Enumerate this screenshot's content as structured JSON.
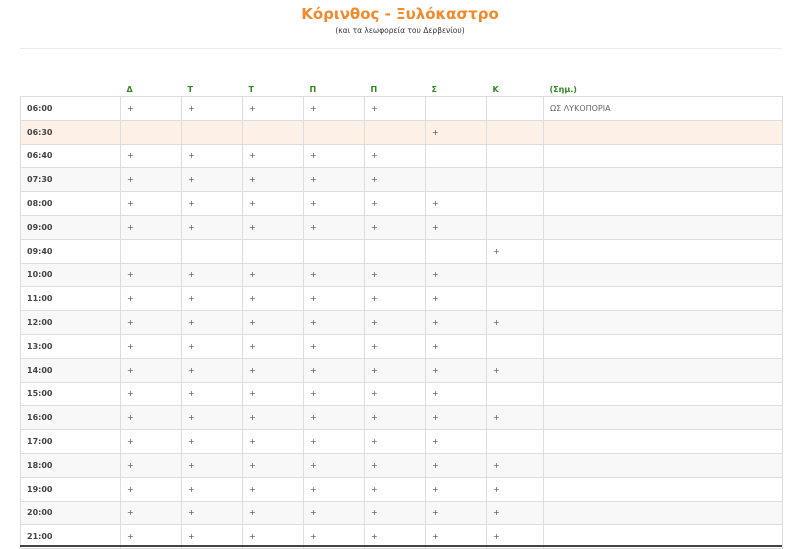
{
  "header": {
    "title": "Κόρινθος - Ξυλόκαστρο",
    "subtitle": "(και τα λεωφορεία του Δερβενίου)"
  },
  "colors": {
    "title": "#f08a2a",
    "day_headers": "#2e8b1e",
    "highlight_row": "#fdf0e6"
  },
  "table": {
    "columns": [
      "",
      "Δ",
      "Τ",
      "Τ",
      "Π",
      "Π",
      "Σ",
      "Κ",
      "(Σημ.)"
    ],
    "rows": [
      {
        "time": "06:00",
        "cells": [
          "+",
          "+",
          "+",
          "+",
          "+",
          "",
          ""
        ],
        "note": "ΩΣ ΛΥΚΟΠΟΡΙΑ",
        "highlight": false
      },
      {
        "time": "06:30",
        "cells": [
          "",
          "",
          "",
          "",
          "",
          "+",
          ""
        ],
        "note": "",
        "highlight": true
      },
      {
        "time": "06:40",
        "cells": [
          "+",
          "+",
          "+",
          "+",
          "+",
          "",
          ""
        ],
        "note": "",
        "highlight": false
      },
      {
        "time": "07:30",
        "cells": [
          "+",
          "+",
          "+",
          "+",
          "+",
          "",
          ""
        ],
        "note": "",
        "highlight": false
      },
      {
        "time": "08:00",
        "cells": [
          "+",
          "+",
          "+",
          "+",
          "+",
          "+",
          ""
        ],
        "note": "",
        "highlight": false
      },
      {
        "time": "09:00",
        "cells": [
          "+",
          "+",
          "+",
          "+",
          "+",
          "+",
          ""
        ],
        "note": "",
        "highlight": false
      },
      {
        "time": "09:40",
        "cells": [
          "",
          "",
          "",
          "",
          "",
          "",
          "+"
        ],
        "note": "",
        "highlight": false
      },
      {
        "time": "10:00",
        "cells": [
          "+",
          "+",
          "+",
          "+",
          "+",
          "+",
          ""
        ],
        "note": "",
        "highlight": false
      },
      {
        "time": "11:00",
        "cells": [
          "+",
          "+",
          "+",
          "+",
          "+",
          "+",
          ""
        ],
        "note": "",
        "highlight": false
      },
      {
        "time": "12:00",
        "cells": [
          "+",
          "+",
          "+",
          "+",
          "+",
          "+",
          "+"
        ],
        "note": "",
        "highlight": false
      },
      {
        "time": "13:00",
        "cells": [
          "+",
          "+",
          "+",
          "+",
          "+",
          "+",
          ""
        ],
        "note": "",
        "highlight": false
      },
      {
        "time": "14:00",
        "cells": [
          "+",
          "+",
          "+",
          "+",
          "+",
          "+",
          "+"
        ],
        "note": "",
        "highlight": false
      },
      {
        "time": "15:00",
        "cells": [
          "+",
          "+",
          "+",
          "+",
          "+",
          "+",
          ""
        ],
        "note": "",
        "highlight": false
      },
      {
        "time": "16:00",
        "cells": [
          "+",
          "+",
          "+",
          "+",
          "+",
          "+",
          "+"
        ],
        "note": "",
        "highlight": false
      },
      {
        "time": "17:00",
        "cells": [
          "+",
          "+",
          "+",
          "+",
          "+",
          "+",
          ""
        ],
        "note": "",
        "highlight": false
      },
      {
        "time": "18:00",
        "cells": [
          "+",
          "+",
          "+",
          "+",
          "+",
          "+",
          "+"
        ],
        "note": "",
        "highlight": false
      },
      {
        "time": "19:00",
        "cells": [
          "+",
          "+",
          "+",
          "+",
          "+",
          "+",
          "+"
        ],
        "note": "",
        "highlight": false
      },
      {
        "time": "20:00",
        "cells": [
          "+",
          "+",
          "+",
          "+",
          "+",
          "+",
          "+"
        ],
        "note": "",
        "highlight": false
      },
      {
        "time": "21:00",
        "cells": [
          "+",
          "+",
          "+",
          "+",
          "+",
          "+",
          "+"
        ],
        "note": "",
        "highlight": false
      }
    ]
  }
}
